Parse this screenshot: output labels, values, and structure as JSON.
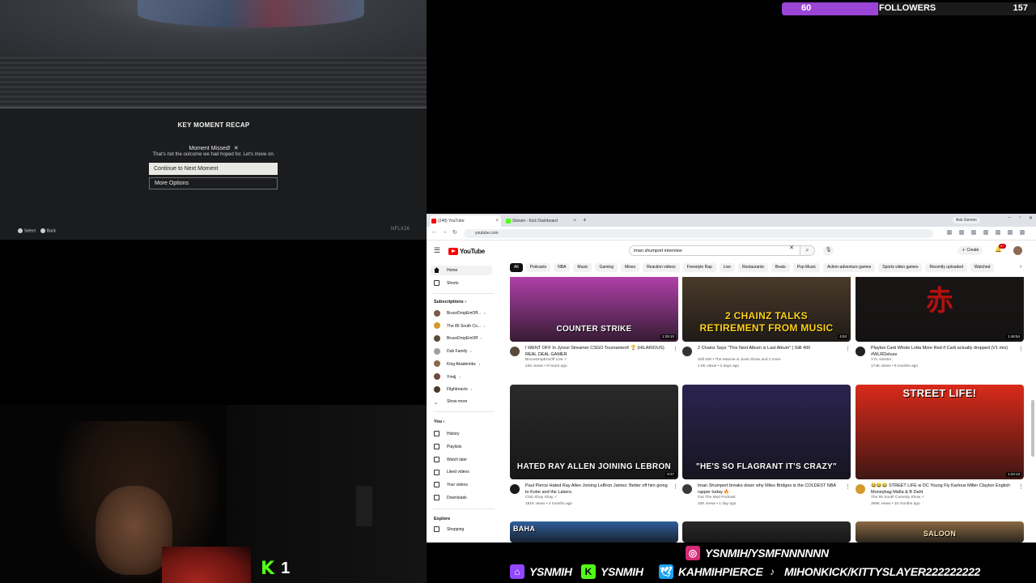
{
  "stream": {
    "followers": {
      "current": "60",
      "label": "FOLLOWERS",
      "goal": "157",
      "progress": 0.38,
      "fill_color": "#9a45d6"
    },
    "kick_viewers": {
      "icon": "kick-logo-icon",
      "count": "1"
    },
    "socials": [
      {
        "icon": "instagram-icon",
        "handle": "YSNMIH/YSMFNNNNNN",
        "color": "#d62976"
      },
      {
        "icon": "twitch-icon",
        "handle": "YSNMIH",
        "color": "#9146ff"
      },
      {
        "icon": "kick-icon",
        "handle": "YSNMIH",
        "color": "#53fc18"
      },
      {
        "icon": "twitter-icon",
        "handle": "KAHMIHPIERCE",
        "color": "#1da1f2"
      },
      {
        "icon": "tiktok-icon",
        "handle": "MIHONKICK/KITTYSLAYER222222222",
        "color": "#000000"
      }
    ]
  },
  "game": {
    "recap_title": "KEY MOMENT RECAP",
    "moment_missed": "Moment Missed!",
    "moment_sub": "That's not the outcome we had hoped for. Let's move on.",
    "continue_label": "Continue to Next Moment",
    "more_label": "More Options",
    "footer_select": "Select",
    "footer_back": "Back",
    "logo_text": "NFLX26"
  },
  "browser": {
    "tabs": [
      {
        "label": "(248) YouTube",
        "icon": "youtube-favicon-icon",
        "active": true
      },
      {
        "label": "Stream - Kick Dashboard",
        "icon": "kick-favicon-icon",
        "active": false
      }
    ],
    "ask_gemini": "Ask Gemini",
    "url": "youtube.com"
  },
  "youtube": {
    "logo": "YouTube",
    "search_value": "iman shumport interview",
    "create_label": "Create",
    "notif_badge": "9+",
    "chips": [
      "All",
      "Podcasts",
      "NBA",
      "Music",
      "Gaming",
      "Mixes",
      "Reaction videos",
      "Freestyle Rap",
      "Live",
      "Restaurants",
      "Beats",
      "Pop Music",
      "Action-adventure games",
      "Sports video games",
      "Recently uploaded",
      "Watched"
    ],
    "sidebar": {
      "home": "Home",
      "shorts": "Shorts",
      "subscriptions_head": "Subscriptions",
      "subscriptions": [
        {
          "name": "BruceDropEmOff...",
          "color": "#7a5a4a"
        },
        {
          "name": "The 85 South Co...",
          "color": "#d49a2a"
        },
        {
          "name": "BruceDropEmOff",
          "color": "#5a4a3a"
        },
        {
          "name": "Dub Family",
          "color": "#a0a0a0"
        },
        {
          "name": "King Akademiks",
          "color": "#8a6a4a"
        },
        {
          "name": "Ymdj",
          "color": "#6a4a3a"
        },
        {
          "name": "Flightreacts",
          "color": "#4a3a2a"
        }
      ],
      "show_more": "Show more",
      "you_head": "You",
      "you_items": [
        "History",
        "Playlists",
        "Watch later",
        "Liked videos",
        "Your videos",
        "Downloads"
      ],
      "explore_head": "Explore",
      "explore_items": [
        "Shopping"
      ]
    },
    "videos": [
      {
        "caption": "COUNTER STRIKE",
        "duration": "1:29:10",
        "title": "I WENT OFF In Jynxzi Streamer CSGO Tournament! 🏆 (HILARIOUS) REAL DEAL GAMER",
        "channel": "BruceDropEmOff Live ✓",
        "stats": "23K views • 8 hours ago",
        "bg": "#b040a8",
        "cap_color": "#ffffff",
        "av": "#5a4a3a"
      },
      {
        "caption": "2 CHAINZ TALKS\nRETIREMENT FROM MUSIC",
        "duration": "4:53",
        "title": "2 Chainz Says \"This Next Album is Last Album\" | Still 400",
        "channel": "Still 400 • The Mannie & Juvie Show and 2 more",
        "stats": "1.9K views • 2 days ago",
        "bg": "#4a3a2a",
        "cap_color": "#ffd21a",
        "av": "#333333"
      },
      {
        "caption": "赤",
        "duration": "1:49:54",
        "title": "Playboi Carti Whole Lotta More Red if Carti actually dropped (V1 mix) #WLRDeluxe",
        "channel": "YYL sinister",
        "stats": "174K views • 9 months ago",
        "bg": "#1a1515",
        "cap_color": "#b01010",
        "av": "#222222"
      },
      {
        "caption": "HATED RAY ALLEN JOINING LEBRON",
        "duration": "9:27",
        "title": "Paul Pierce Hated Ray Allen Joining LeBron James: Better off him going to Kobe and the Lakers.",
        "channel": "Club Shay Shay ✓",
        "stats": "181K views • 4 months ago",
        "bg": "#2a2a2a",
        "cap_color": "#ffffff",
        "av": "#1a1a1a"
      },
      {
        "caption": "\"HE'S SO FLAGRANT IT'S CRAZY\"",
        "duration": "",
        "title": "Iman Shumpert breaks down why Miles Bridges is the COLDEST NBA rapper today 🔥",
        "channel": "Out The Mud Podcast",
        "stats": "33K views • 1 day ago",
        "bg": "#2a2450",
        "cap_color": "#ffffff",
        "av": "#3a3a3a"
      },
      {
        "caption": "STREET LIFE!",
        "duration": "1:23:13",
        "title": "😂😂😂 STREET LIFE w DC Young Fly Karlous Miller Clayton English Moneybag Mafia & B Daht",
        "channel": "The 85 South Comedy Show ✓",
        "stats": "399K views • 10 months ago",
        "bg": "#d92a1a",
        "cap_color": "#ffffff",
        "av": "#d49a2a"
      },
      {
        "caption": "BAHA",
        "duration": "",
        "title": "",
        "channel": "",
        "stats": "",
        "bg": "#2f5e9a",
        "cap_color": "#ffffff",
        "av": "#444444"
      },
      {
        "caption": "",
        "duration": "",
        "title": "",
        "channel": "",
        "stats": "",
        "bg": "#2a2a2a",
        "cap_color": "#ffffff",
        "av": "#444444"
      },
      {
        "caption": "SALOON",
        "duration": "",
        "title": "",
        "channel": "",
        "stats": "",
        "bg": "#8a6a45",
        "cap_color": "#f3e1b0",
        "av": "#444444"
      }
    ]
  }
}
